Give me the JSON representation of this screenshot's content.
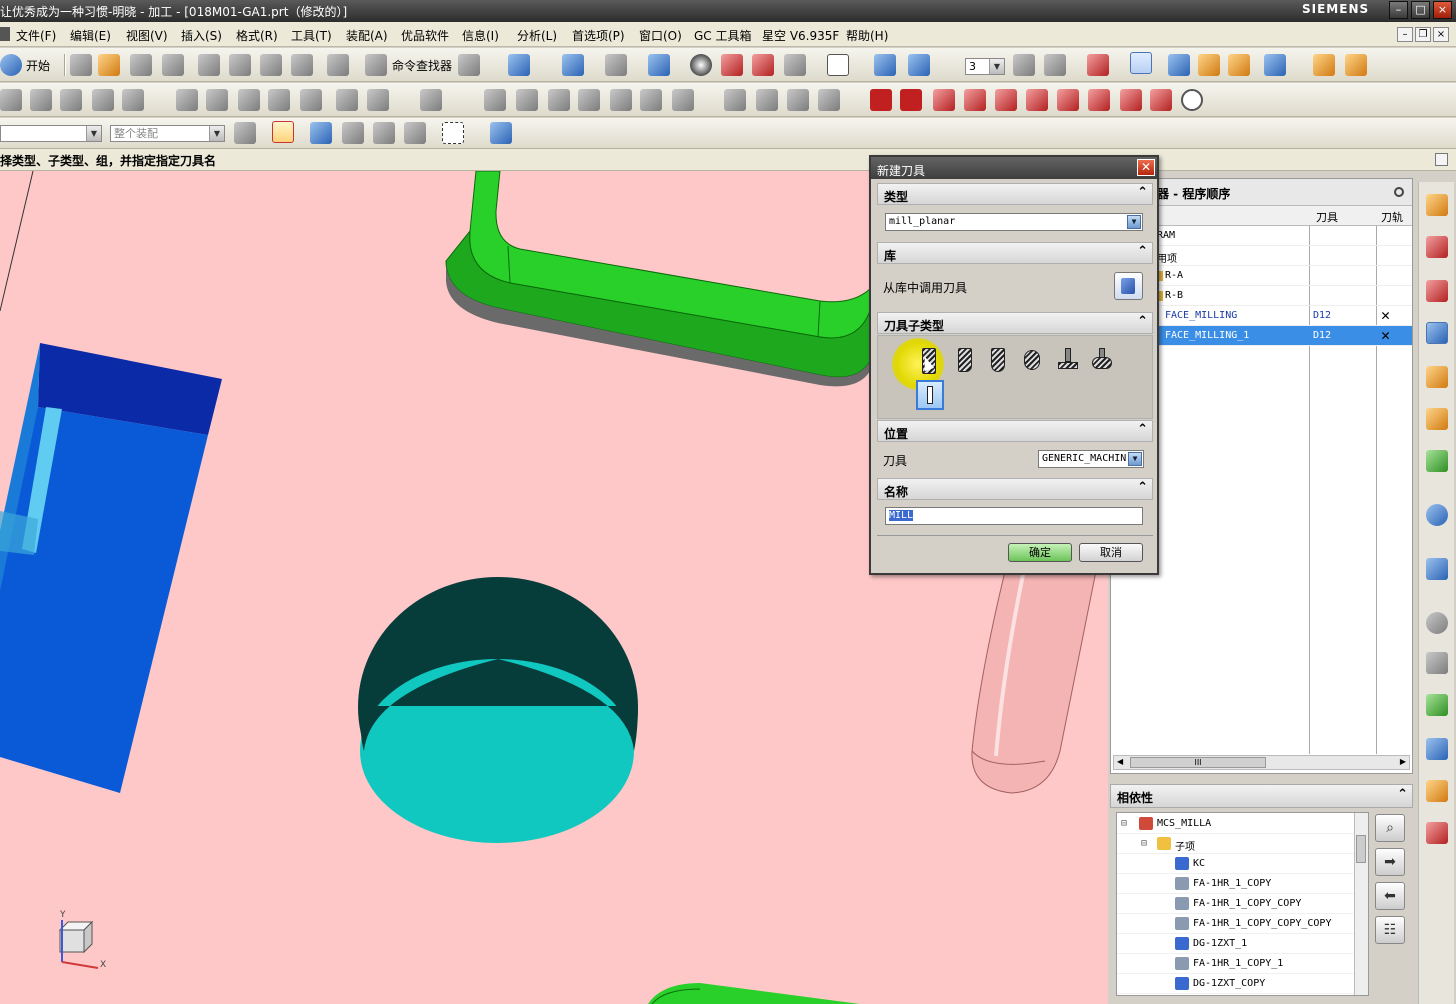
{
  "window": {
    "title": "让优秀成为一种习惯-明晓 - 加工 - [018M01-GA1.prt（修改的）]",
    "brand": "SIEMENS",
    "controls": [
      "–",
      "□",
      "×"
    ]
  },
  "menu": {
    "items": [
      "文件(F)",
      "编辑(E)",
      "视图(V)",
      "插入(S)",
      "格式(R)",
      "工具(T)",
      "装配(A)",
      "优品软件",
      "信息(I)",
      "分析(L)",
      "首选项(P)",
      "窗口(O)",
      "GC 工具箱",
      "星空 V6.935F",
      "帮助(H)"
    ],
    "mdi_controls": [
      "–",
      "❐",
      "×"
    ]
  },
  "toolbar": {
    "start_label": "开始",
    "command_finder_label": "命令查找器",
    "layer_value": "3",
    "filter_value": "整个装配"
  },
  "cue_line": "择类型、子类型、组，并指定指定刀具名",
  "dialog": {
    "title": "新建刀具",
    "type_section": "类型",
    "type_value": "mill_planar",
    "library_section": "库",
    "library_label": "从库中调用刀具",
    "subtype_section": "刀具子类型",
    "subtype_icons": [
      "mill-icon",
      "chamfer-mill-icon",
      "ball-mill-icon",
      "spherical-mill-icon",
      "t-cutter-icon",
      "barrel-cutter-icon",
      "thread-mill-icon"
    ],
    "location_section": "位置",
    "tool_label": "刀具",
    "tool_value": "GENERIC_MACHIN",
    "name_section": "名称",
    "name_value": "MILL",
    "ok_label": "确定",
    "cancel_label": "取消"
  },
  "navigator": {
    "title": "器 - 程序顺序",
    "columns": [
      "刀具",
      "刀轨"
    ],
    "rows": [
      {
        "name": "RAM",
        "tool": "",
        "path": ""
      },
      {
        "name": "用项",
        "tool": "",
        "path": ""
      },
      {
        "name": "R-A",
        "tool": "",
        "path": ""
      },
      {
        "name": "R-B",
        "tool": "",
        "path": ""
      },
      {
        "name": "FACE_MILLING",
        "tool": "D12",
        "path": "✕"
      },
      {
        "name": "FACE_MILLING_1",
        "tool": "D12",
        "path": "✕"
      }
    ],
    "selected_row": 5,
    "scroll_grip": "III"
  },
  "dependencies": {
    "title": "相依性",
    "items": [
      {
        "label": "MCS_MILLA",
        "icon": "mcs-icon"
      },
      {
        "label": "子项",
        "icon": "folder-icon"
      },
      {
        "label": "KC",
        "icon": "tool-icon"
      },
      {
        "label": "FA-1HR_1_COPY",
        "icon": "operation-icon"
      },
      {
        "label": "FA-1HR_1_COPY_COPY",
        "icon": "operation-icon"
      },
      {
        "label": "FA-1HR_1_COPY_COPY_COPY",
        "icon": "operation-icon"
      },
      {
        "label": "DG-1ZXT_1",
        "icon": "tool-icon"
      },
      {
        "label": "FA-1HR_1_COPY_1",
        "icon": "operation-icon"
      },
      {
        "label": "DG-1ZXT_COPY",
        "icon": "tool-icon"
      }
    ]
  },
  "triad": {
    "x": "X",
    "y": "Y"
  },
  "colors": {
    "background": "#ffc8c8",
    "green_part": "#22c41e",
    "blue_block": "#0a5ad8",
    "hole": "#10c8c0",
    "pin": "#f0b0b0",
    "selection": "#3a8ee6"
  }
}
